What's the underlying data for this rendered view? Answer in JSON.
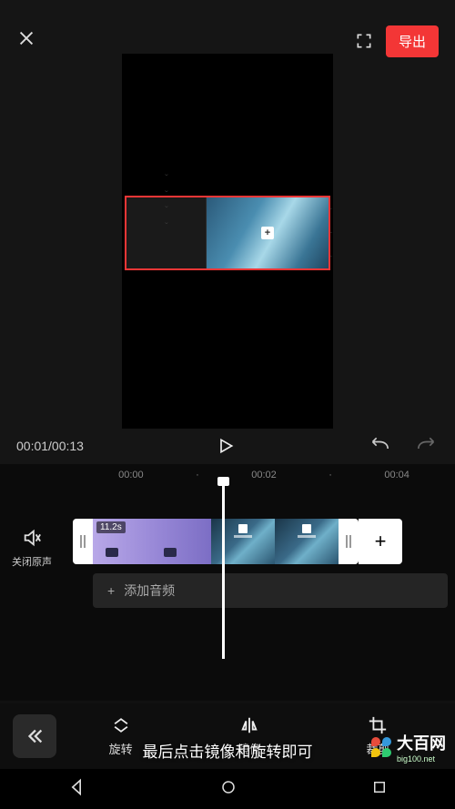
{
  "header": {
    "export_label": "导出"
  },
  "playback": {
    "time_display": "00:01/00:13"
  },
  "timeline": {
    "ruler_marks": [
      "00:00",
      "00:02",
      "00:04"
    ],
    "mute_label": "关闭原声",
    "clip1_duration": "11.2s",
    "add_audio_label": "添加音频",
    "add_audio_plus": "+"
  },
  "toolbar": {
    "rotate_label": "旋转",
    "mirror_label": "镜像",
    "crop_label": "裁剪"
  },
  "subtitle": {
    "text": "最后点击镜像和旋转即可"
  },
  "watermark": {
    "brand": "大百网",
    "url": "big100.net"
  }
}
